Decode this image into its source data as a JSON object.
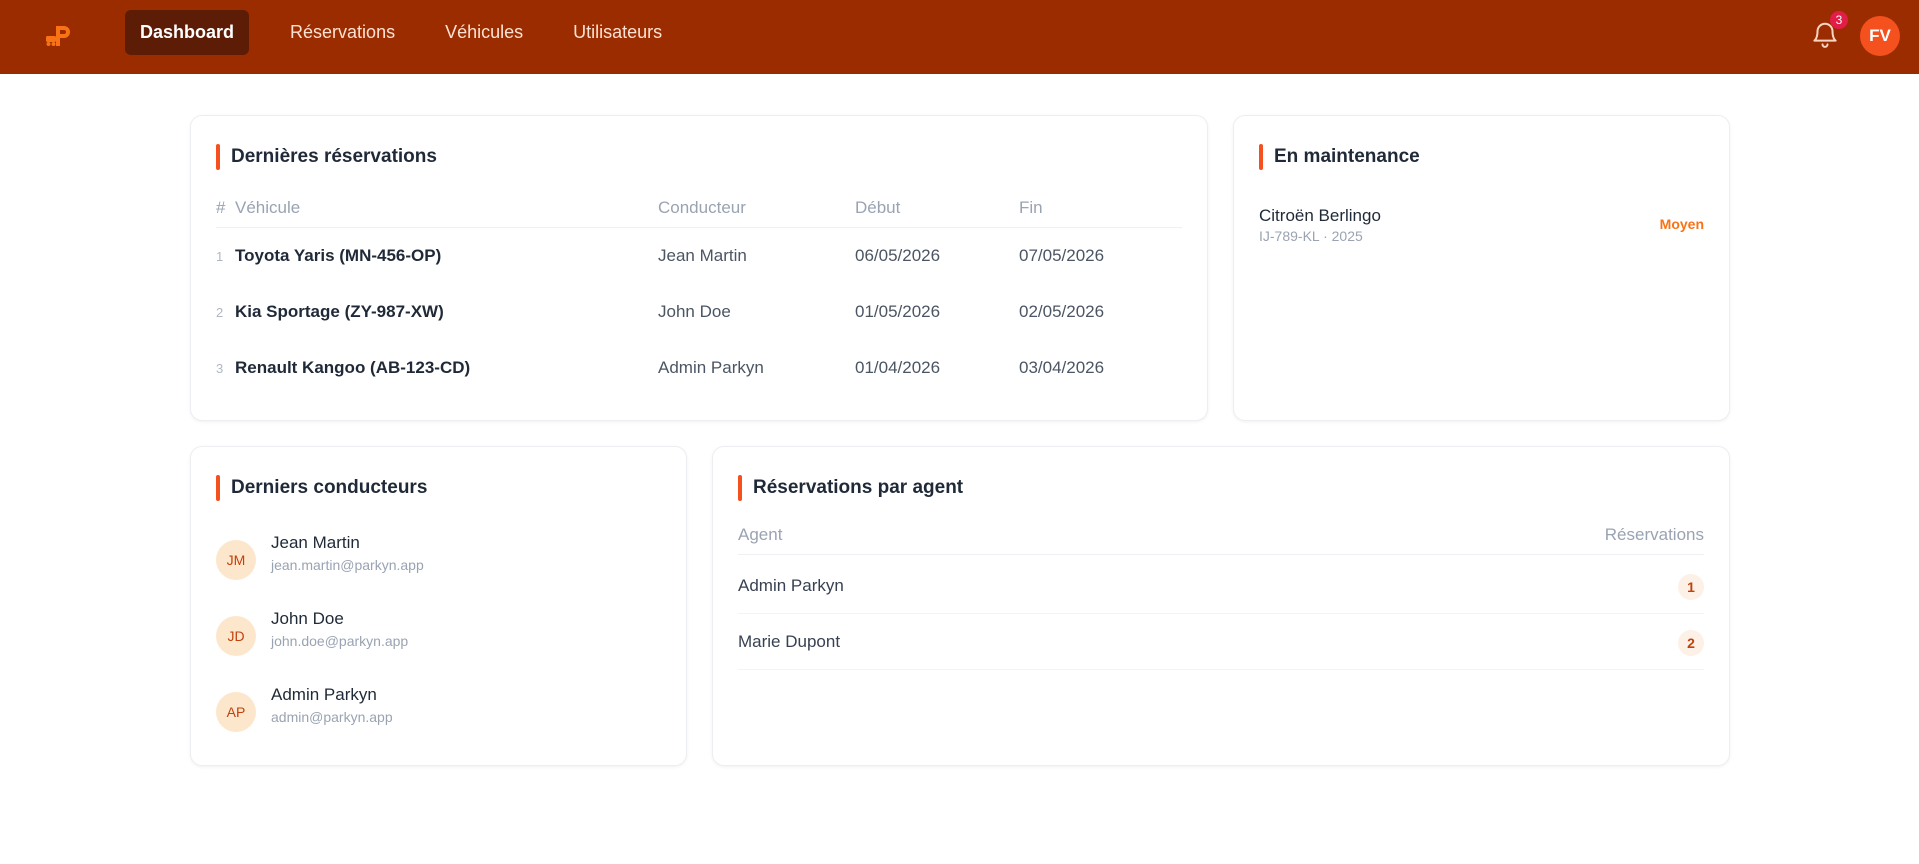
{
  "nav": {
    "items": [
      {
        "label": "Dashboard",
        "active": true
      },
      {
        "label": "Réservations",
        "active": false
      },
      {
        "label": "Véhicules",
        "active": false
      },
      {
        "label": "Utilisateurs",
        "active": false
      }
    ]
  },
  "header": {
    "notification_count": "3",
    "user_initials": "FV"
  },
  "reservations": {
    "title": "Dernières réservations",
    "columns": [
      "#",
      "Véhicule",
      "Conducteur",
      "Début",
      "Fin"
    ],
    "rows": [
      {
        "idx": "1",
        "vehicle": "Toyota Yaris (MN-456-OP)",
        "driver": "Jean Martin",
        "start": "06/05/2026",
        "end": "07/05/2026"
      },
      {
        "idx": "2",
        "vehicle": "Kia Sportage (ZY-987-XW)",
        "driver": "John Doe",
        "start": "01/05/2026",
        "end": "02/05/2026"
      },
      {
        "idx": "3",
        "vehicle": "Renault Kangoo (AB-123-CD)",
        "driver": "Admin Parkyn",
        "start": "01/04/2026",
        "end": "03/04/2026"
      }
    ]
  },
  "maintenance": {
    "title": "En maintenance",
    "items": [
      {
        "name": "Citroën Berlingo",
        "sub": "IJ-789-KL · 2025",
        "status": "Moyen"
      }
    ]
  },
  "drivers": {
    "title": "Derniers conducteurs",
    "items": [
      {
        "initials": "JM",
        "name": "Jean Martin",
        "email": "jean.martin@parkyn.app"
      },
      {
        "initials": "JD",
        "name": "John Doe",
        "email": "john.doe@parkyn.app"
      },
      {
        "initials": "AP",
        "name": "Admin Parkyn",
        "email": "admin@parkyn.app"
      }
    ]
  },
  "agents": {
    "title": "Réservations par agent",
    "columns": [
      "Agent",
      "Réservations"
    ],
    "rows": [
      {
        "name": "Admin Parkyn",
        "count": "1"
      },
      {
        "name": "Marie Dupont",
        "count": "2"
      }
    ]
  },
  "colors": {
    "topbar": "#9a2c00",
    "nav_active": "#5c1c05",
    "accent": "#f4511e",
    "badge": "#e11d48",
    "status_medium": "#f97316"
  }
}
